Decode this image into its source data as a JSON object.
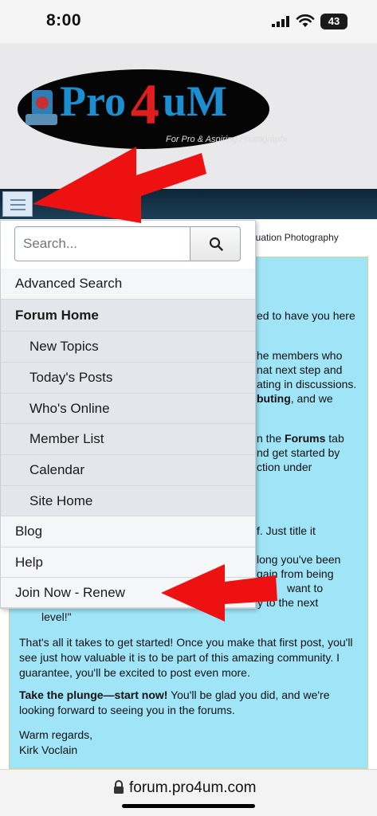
{
  "status_bar": {
    "time": "8:00",
    "battery": "43"
  },
  "logo": {
    "name": "Pro4uM",
    "tagline": "For Pro & Aspiring Photographers"
  },
  "breadcrumb": "duation Photography",
  "menu": {
    "search_placeholder": "Search...",
    "items": [
      {
        "label": "Advanced Search"
      },
      {
        "label": "Forum Home"
      },
      {
        "label": "New Topics"
      },
      {
        "label": "Today's Posts"
      },
      {
        "label": "Who's Online"
      },
      {
        "label": "Member List"
      },
      {
        "label": "Calendar"
      },
      {
        "label": "Site Home"
      },
      {
        "label": "Blog"
      },
      {
        "label": "Help"
      },
      {
        "label": "Join Now - Renew"
      }
    ]
  },
  "notice": {
    "fragments": [
      "ed to have you here",
      "he members who",
      "nat next step and",
      "ating in discussions.",
      "buting",
      ", and we",
      "n the ",
      "Forums",
      " tab",
      "nd get started by",
      "ction under",
      "f. Just title it",
      "long you've been",
      "gain from being",
      "want to",
      "y to the next",
      "level!\""
    ],
    "para1": "That's all it takes to get started! Once you make that first post, you'll see just how valuable it is to be part of this amazing community. I guarantee, you'll be excited to post even more.",
    "para2_bold": "Take the plunge—start now!",
    "para2_rest": " You'll be glad you did, and we're looking forward to seeing you in the forums.",
    "closing": "Warm regards,",
    "signature": "Kirk Voclain"
  },
  "url_bar": {
    "domain": "forum.pro4um.com"
  },
  "colors": {
    "navbar": "#0e2535",
    "notice_bg": "#9fe4f7",
    "arrow": "#ee1111",
    "logo_blue": "#1a8fd1"
  }
}
